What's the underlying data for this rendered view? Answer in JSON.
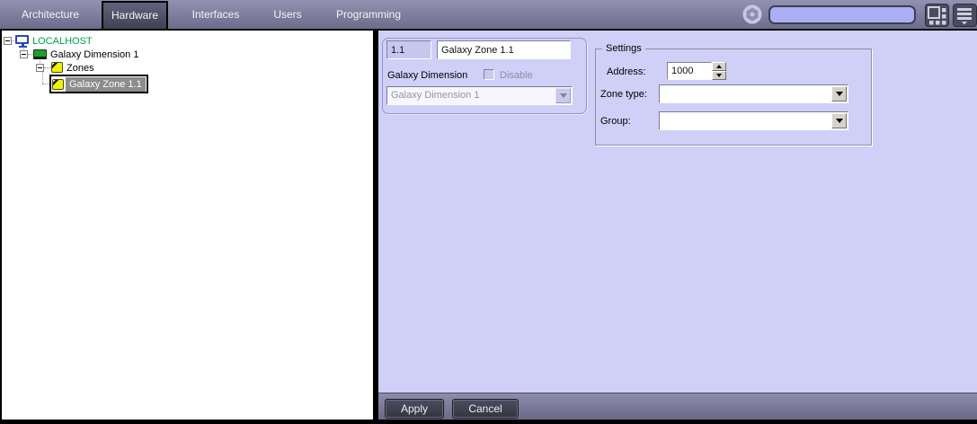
{
  "topbar": {
    "tabs": [
      {
        "label": "Architecture",
        "selected": false
      },
      {
        "label": "Hardware",
        "selected": true
      },
      {
        "label": "Interfaces",
        "selected": false
      },
      {
        "label": "Users",
        "selected": false
      },
      {
        "label": "Programming",
        "selected": false
      }
    ],
    "search": {
      "value": "",
      "placeholder": ""
    },
    "icons": {
      "gear": "hex-gear",
      "layout": "screen-tiles",
      "menu": "hamburger-with-arrow"
    }
  },
  "tree": {
    "items": [
      {
        "label": "LOCALHOST",
        "icon": "computer-monitor",
        "level": 0
      },
      {
        "label": "Galaxy Dimension 1",
        "icon": "green-board",
        "level": 1
      },
      {
        "label": "Zones",
        "icon": "yellow-zone",
        "level": 2
      },
      {
        "label": "Galaxy Zone 1.1",
        "icon": "yellow-zone",
        "level": 3,
        "selected": true
      }
    ]
  },
  "panel": {
    "id_value": "1.1",
    "name_value": "Galaxy Zone 1.1",
    "parent_label": "Galaxy Dimension",
    "disable_label": "Disable",
    "disable_checked": false,
    "parent_dropdown_value": "Galaxy Dimension 1",
    "settings": {
      "legend": "Settings",
      "address_label": "Address:",
      "address_value": "1000",
      "zone_type_label": "Zone type:",
      "zone_type_value": "",
      "group_label": "Group:",
      "group_value": ""
    },
    "buttons": {
      "apply": "Apply",
      "cancel": "Cancel"
    }
  },
  "colors": {
    "topbar_top": "#9292b0",
    "topbar_bottom": "#6d6d8b",
    "selected_tab_bg": "#414153",
    "panel_bg": "#cfcff7",
    "search_bg": "#a9aff2",
    "localhost_text": "#00a14e",
    "selection_bg": "#8c8c8c",
    "zone_icon_yellow": "#f2f200",
    "board_icon_green": "#1e9e2e"
  }
}
